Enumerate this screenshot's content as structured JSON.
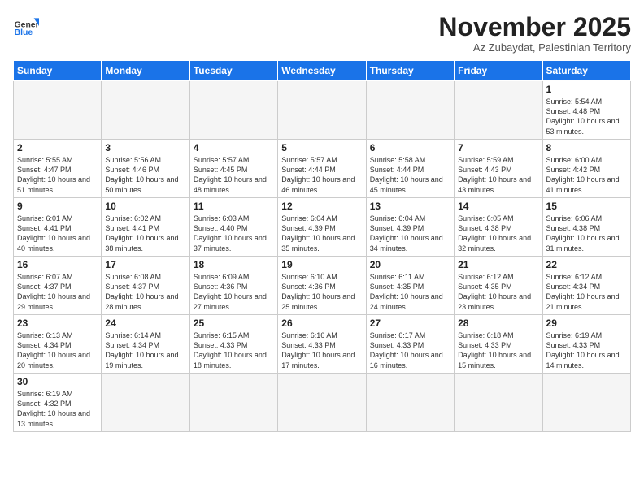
{
  "logo": {
    "text_general": "General",
    "text_blue": "Blue"
  },
  "title": "November 2025",
  "subtitle": "Az Zubaydat, Palestinian Territory",
  "days_of_week": [
    "Sunday",
    "Monday",
    "Tuesday",
    "Wednesday",
    "Thursday",
    "Friday",
    "Saturday"
  ],
  "weeks": [
    [
      {
        "num": "",
        "info": ""
      },
      {
        "num": "",
        "info": ""
      },
      {
        "num": "",
        "info": ""
      },
      {
        "num": "",
        "info": ""
      },
      {
        "num": "",
        "info": ""
      },
      {
        "num": "",
        "info": ""
      },
      {
        "num": "1",
        "info": "Sunrise: 5:54 AM\nSunset: 4:48 PM\nDaylight: 10 hours and 53 minutes."
      }
    ],
    [
      {
        "num": "2",
        "info": "Sunrise: 5:55 AM\nSunset: 4:47 PM\nDaylight: 10 hours and 51 minutes."
      },
      {
        "num": "3",
        "info": "Sunrise: 5:56 AM\nSunset: 4:46 PM\nDaylight: 10 hours and 50 minutes."
      },
      {
        "num": "4",
        "info": "Sunrise: 5:57 AM\nSunset: 4:45 PM\nDaylight: 10 hours and 48 minutes."
      },
      {
        "num": "5",
        "info": "Sunrise: 5:57 AM\nSunset: 4:44 PM\nDaylight: 10 hours and 46 minutes."
      },
      {
        "num": "6",
        "info": "Sunrise: 5:58 AM\nSunset: 4:44 PM\nDaylight: 10 hours and 45 minutes."
      },
      {
        "num": "7",
        "info": "Sunrise: 5:59 AM\nSunset: 4:43 PM\nDaylight: 10 hours and 43 minutes."
      },
      {
        "num": "8",
        "info": "Sunrise: 6:00 AM\nSunset: 4:42 PM\nDaylight: 10 hours and 41 minutes."
      }
    ],
    [
      {
        "num": "9",
        "info": "Sunrise: 6:01 AM\nSunset: 4:41 PM\nDaylight: 10 hours and 40 minutes."
      },
      {
        "num": "10",
        "info": "Sunrise: 6:02 AM\nSunset: 4:41 PM\nDaylight: 10 hours and 38 minutes."
      },
      {
        "num": "11",
        "info": "Sunrise: 6:03 AM\nSunset: 4:40 PM\nDaylight: 10 hours and 37 minutes."
      },
      {
        "num": "12",
        "info": "Sunrise: 6:04 AM\nSunset: 4:39 PM\nDaylight: 10 hours and 35 minutes."
      },
      {
        "num": "13",
        "info": "Sunrise: 6:04 AM\nSunset: 4:39 PM\nDaylight: 10 hours and 34 minutes."
      },
      {
        "num": "14",
        "info": "Sunrise: 6:05 AM\nSunset: 4:38 PM\nDaylight: 10 hours and 32 minutes."
      },
      {
        "num": "15",
        "info": "Sunrise: 6:06 AM\nSunset: 4:38 PM\nDaylight: 10 hours and 31 minutes."
      }
    ],
    [
      {
        "num": "16",
        "info": "Sunrise: 6:07 AM\nSunset: 4:37 PM\nDaylight: 10 hours and 29 minutes."
      },
      {
        "num": "17",
        "info": "Sunrise: 6:08 AM\nSunset: 4:37 PM\nDaylight: 10 hours and 28 minutes."
      },
      {
        "num": "18",
        "info": "Sunrise: 6:09 AM\nSunset: 4:36 PM\nDaylight: 10 hours and 27 minutes."
      },
      {
        "num": "19",
        "info": "Sunrise: 6:10 AM\nSunset: 4:36 PM\nDaylight: 10 hours and 25 minutes."
      },
      {
        "num": "20",
        "info": "Sunrise: 6:11 AM\nSunset: 4:35 PM\nDaylight: 10 hours and 24 minutes."
      },
      {
        "num": "21",
        "info": "Sunrise: 6:12 AM\nSunset: 4:35 PM\nDaylight: 10 hours and 23 minutes."
      },
      {
        "num": "22",
        "info": "Sunrise: 6:12 AM\nSunset: 4:34 PM\nDaylight: 10 hours and 21 minutes."
      }
    ],
    [
      {
        "num": "23",
        "info": "Sunrise: 6:13 AM\nSunset: 4:34 PM\nDaylight: 10 hours and 20 minutes."
      },
      {
        "num": "24",
        "info": "Sunrise: 6:14 AM\nSunset: 4:34 PM\nDaylight: 10 hours and 19 minutes."
      },
      {
        "num": "25",
        "info": "Sunrise: 6:15 AM\nSunset: 4:33 PM\nDaylight: 10 hours and 18 minutes."
      },
      {
        "num": "26",
        "info": "Sunrise: 6:16 AM\nSunset: 4:33 PM\nDaylight: 10 hours and 17 minutes."
      },
      {
        "num": "27",
        "info": "Sunrise: 6:17 AM\nSunset: 4:33 PM\nDaylight: 10 hours and 16 minutes."
      },
      {
        "num": "28",
        "info": "Sunrise: 6:18 AM\nSunset: 4:33 PM\nDaylight: 10 hours and 15 minutes."
      },
      {
        "num": "29",
        "info": "Sunrise: 6:19 AM\nSunset: 4:33 PM\nDaylight: 10 hours and 14 minutes."
      }
    ],
    [
      {
        "num": "30",
        "info": "Sunrise: 6:19 AM\nSunset: 4:32 PM\nDaylight: 10 hours and 13 minutes."
      },
      {
        "num": "",
        "info": ""
      },
      {
        "num": "",
        "info": ""
      },
      {
        "num": "",
        "info": ""
      },
      {
        "num": "",
        "info": ""
      },
      {
        "num": "",
        "info": ""
      },
      {
        "num": "",
        "info": ""
      }
    ]
  ]
}
